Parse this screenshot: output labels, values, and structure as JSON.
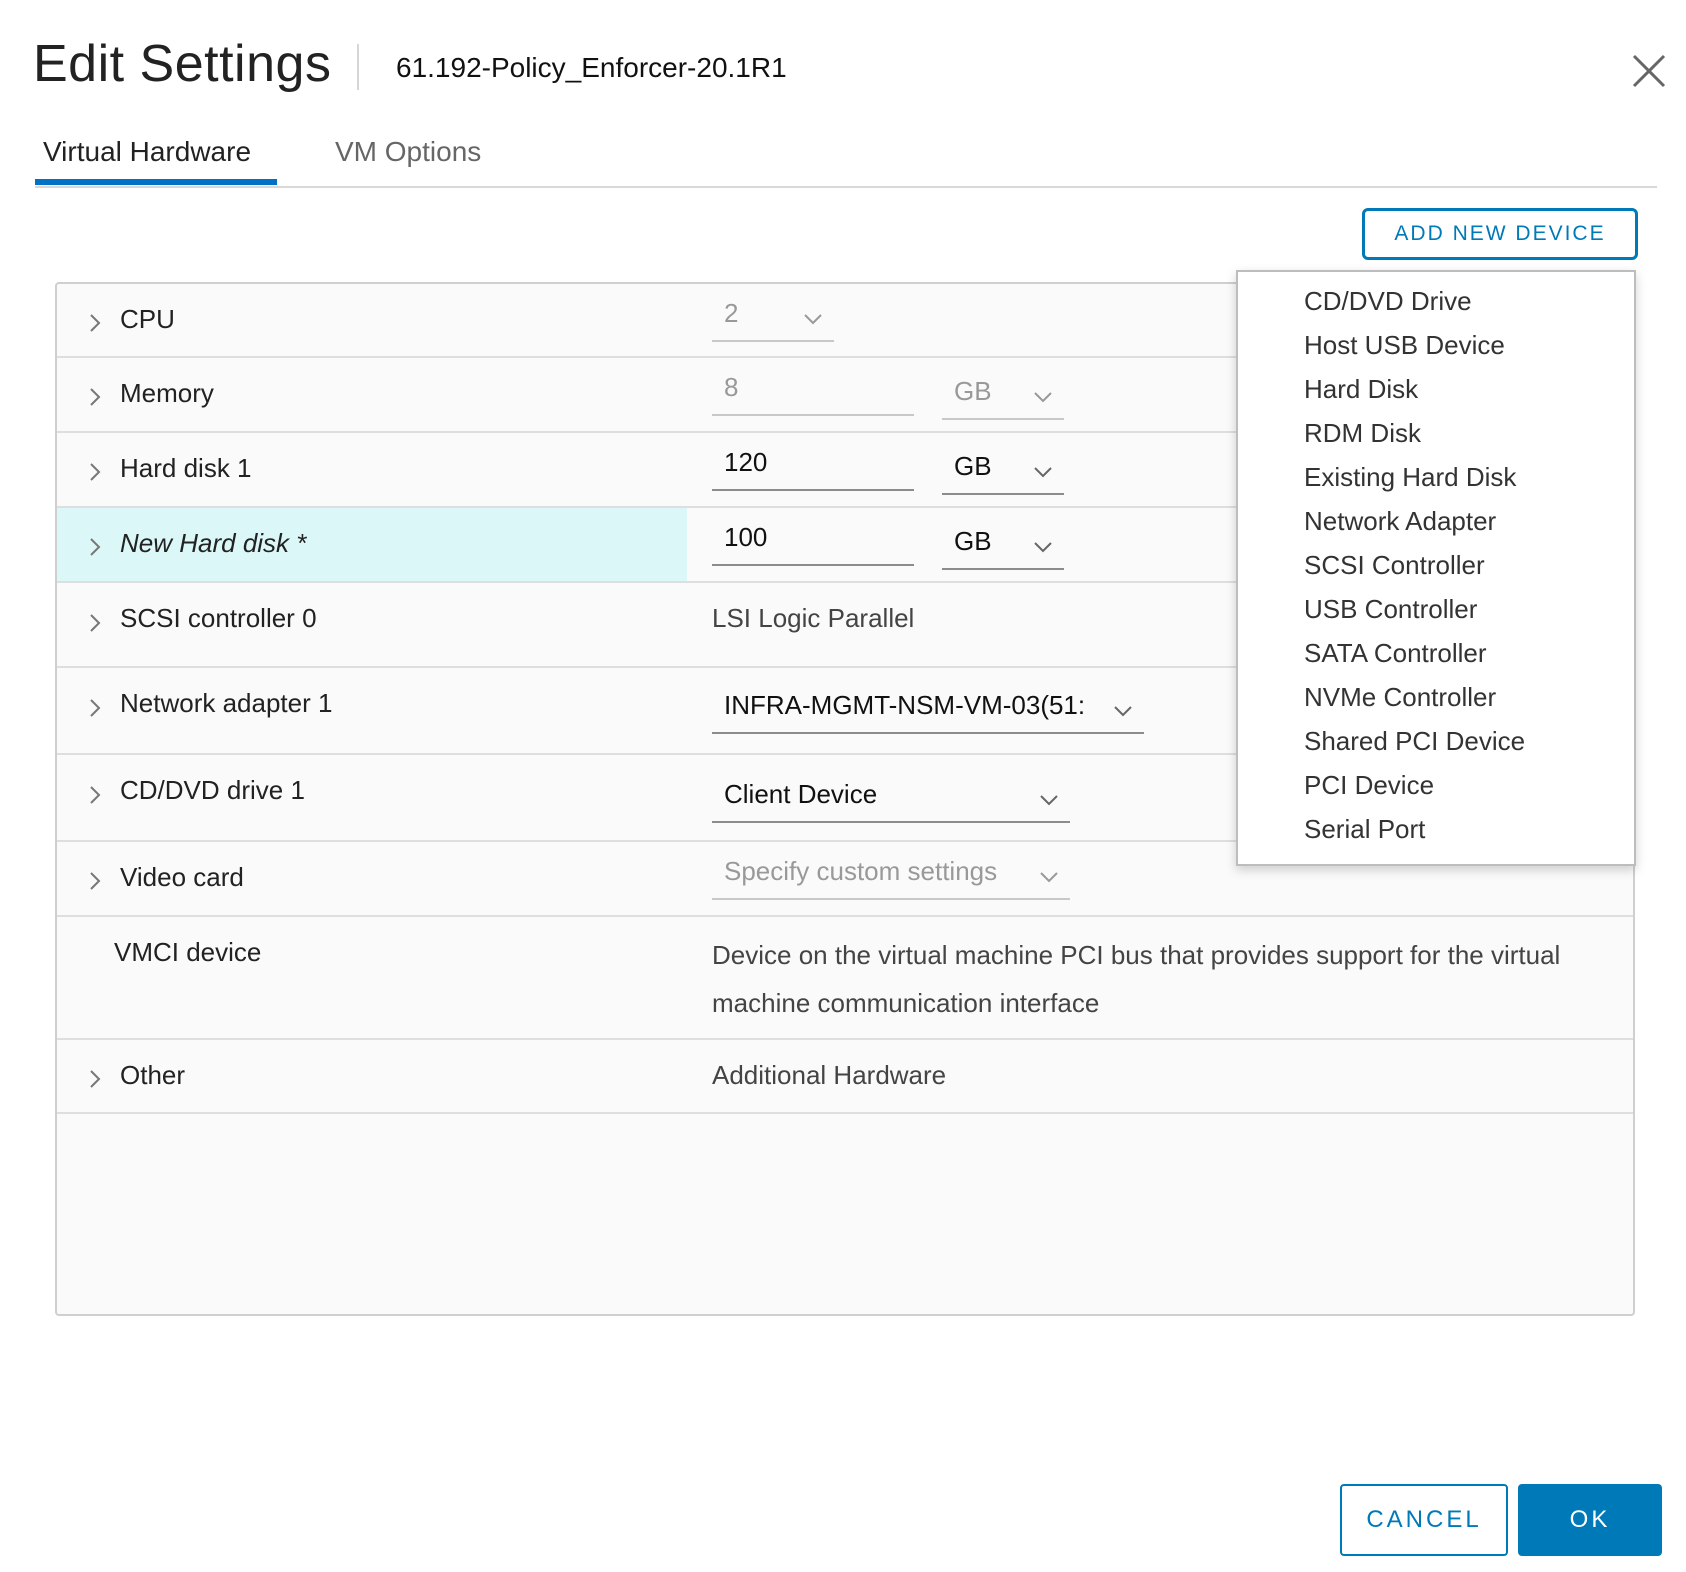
{
  "dialog": {
    "title": "Edit Settings",
    "vm_name": "61.192-Policy_Enforcer-20.1R1"
  },
  "tabs": [
    {
      "label": "Virtual Hardware",
      "active": true
    },
    {
      "label": "VM Options",
      "active": false
    }
  ],
  "add_device_label": "ADD NEW DEVICE",
  "hardware": {
    "cpu": {
      "label": "CPU",
      "value": "2"
    },
    "memory": {
      "label": "Memory",
      "value": "8",
      "unit": "GB"
    },
    "hard_disk_1": {
      "label": "Hard disk 1",
      "value": "120",
      "unit": "GB"
    },
    "new_hard_disk": {
      "label": "New Hard disk *",
      "value": "100",
      "unit": "GB"
    },
    "scsi_controller": {
      "label": "SCSI controller 0",
      "value": "LSI Logic Parallel"
    },
    "network_adapter": {
      "label": "Network adapter 1",
      "value": "INFRA-MGMT-NSM-VM-03(51:"
    },
    "cd_dvd": {
      "label": "CD/DVD drive 1",
      "value": "Client Device"
    },
    "video_card": {
      "label": "Video card",
      "value": "Specify custom settings"
    },
    "vmci": {
      "label": "VMCI device",
      "description": "Device on the virtual machine PCI bus that provides support for the virtual machine communication interface"
    },
    "other": {
      "label": "Other",
      "value": "Additional Hardware"
    }
  },
  "add_device_menu": [
    "CD/DVD Drive",
    "Host USB Device",
    "Hard Disk",
    "RDM Disk",
    "Existing Hard Disk",
    "Network Adapter",
    "SCSI Controller",
    "USB Controller",
    "SATA Controller",
    "NVMe Controller",
    "Shared PCI Device",
    "PCI Device",
    "Serial Port"
  ],
  "footer": {
    "cancel_label": "CANCEL",
    "ok_label": "OK"
  },
  "colors": {
    "accent": "#0079b8",
    "highlight_row": "#dbf7f7"
  },
  "icons": {
    "close": "close-icon",
    "expand": "chevron-right-icon",
    "dropdown": "chevron-down-icon"
  }
}
